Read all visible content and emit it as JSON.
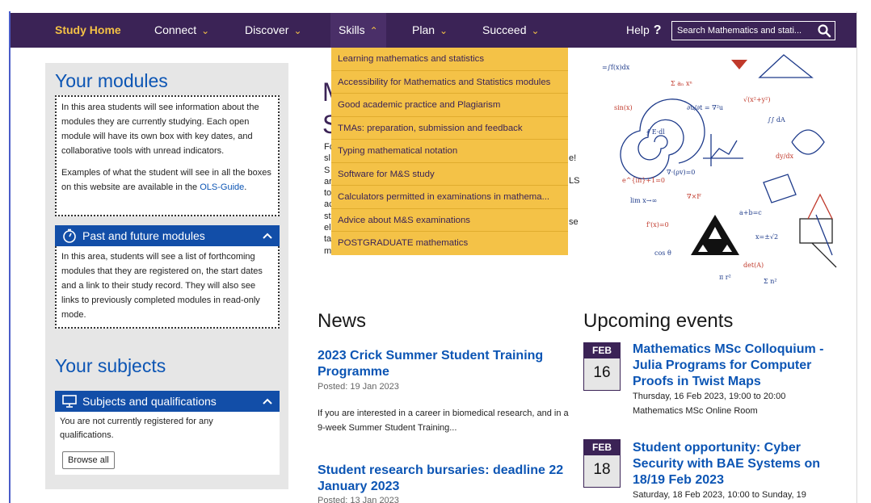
{
  "nav": {
    "home": "Study Home",
    "items": [
      "Connect",
      "Discover",
      "Skills",
      "Plan",
      "Succeed"
    ],
    "help": "Help",
    "help_symbol": "?",
    "search_placeholder": "Search Mathematics and stati..."
  },
  "skills_menu": [
    "Learning mathematics and statistics",
    "Accessibility for Mathematics and Statistics modules",
    "Good academic practice and Plagiarism",
    "TMAs: preparation, submission and feedback",
    "Typing mathematical notation",
    "Software for M&S study",
    "Calculators permitted in examinations in mathema...",
    "Advice about M&S examinations",
    "POSTGRADUATE mathematics"
  ],
  "modules": {
    "title": "Your modules",
    "para1": "In this area students will see information about the modules they are currently studying. Each open module will have its own box with key dates, and collaborative tools with unread indicators.",
    "para2_prefix": "Examples of what the student will see in all the boxes on this website are available in the",
    "para2_link": "OLS-Guide",
    "para2_suffix": ".",
    "past_future_title": "Past and future modules",
    "past_future_text": "In this area, students will see a list of forthcoming modules that they are registered on, the start dates and a link to their study record. They will also see links to previously completed modules in read-only mode."
  },
  "subjects": {
    "title": "Your subjects",
    "bar_title": "Subjects and qualifications",
    "text": "You are not currently registered for any qualifications.",
    "button": "Browse all"
  },
  "intro": {
    "big1": "M",
    "big2": "S",
    "left_chars": [
      "Fo",
      "sl",
      "S",
      "ar",
      "to",
      "ac",
      "st",
      "el",
      "ta",
      "m"
    ],
    "right_chars": [
      "e!",
      "",
      "LS",
      "",
      "",
      "",
      "",
      "se",
      "",
      ""
    ]
  },
  "news": {
    "heading": "News",
    "items": [
      {
        "title": "2023 Crick Summer Student Training Programme",
        "posted": "Posted: 19 Jan 2023",
        "body": "If you are interested in a career in biomedical research, and in a 9-week Summer Student Training..."
      },
      {
        "title": "Student research bursaries: deadline 22 January 2023",
        "posted": "Posted: 13 Jan 2023",
        "body": ""
      }
    ]
  },
  "events": {
    "heading": "Upcoming events",
    "items": [
      {
        "month": "FEB",
        "day": "16",
        "title": "Mathematics MSc Colloquium - Julia Programs for Computer Proofs in Twist Maps",
        "when": "Thursday, 16 Feb 2023, 19:00 to 20:00",
        "where": "Mathematics MSc Online Room"
      },
      {
        "month": "FEB",
        "day": "18",
        "title": "Student opportunity: Cyber Security with BAE Systems on 18/19 Feb 2023",
        "when": "Saturday, 18 Feb 2023, 10:00 to Sunday, 19",
        "where": ""
      }
    ]
  },
  "colors": {
    "nav_bg": "#3b2356",
    "accent_gold": "#f4c247",
    "link_blue": "#0c55b4",
    "bar_blue": "#124ea8"
  }
}
